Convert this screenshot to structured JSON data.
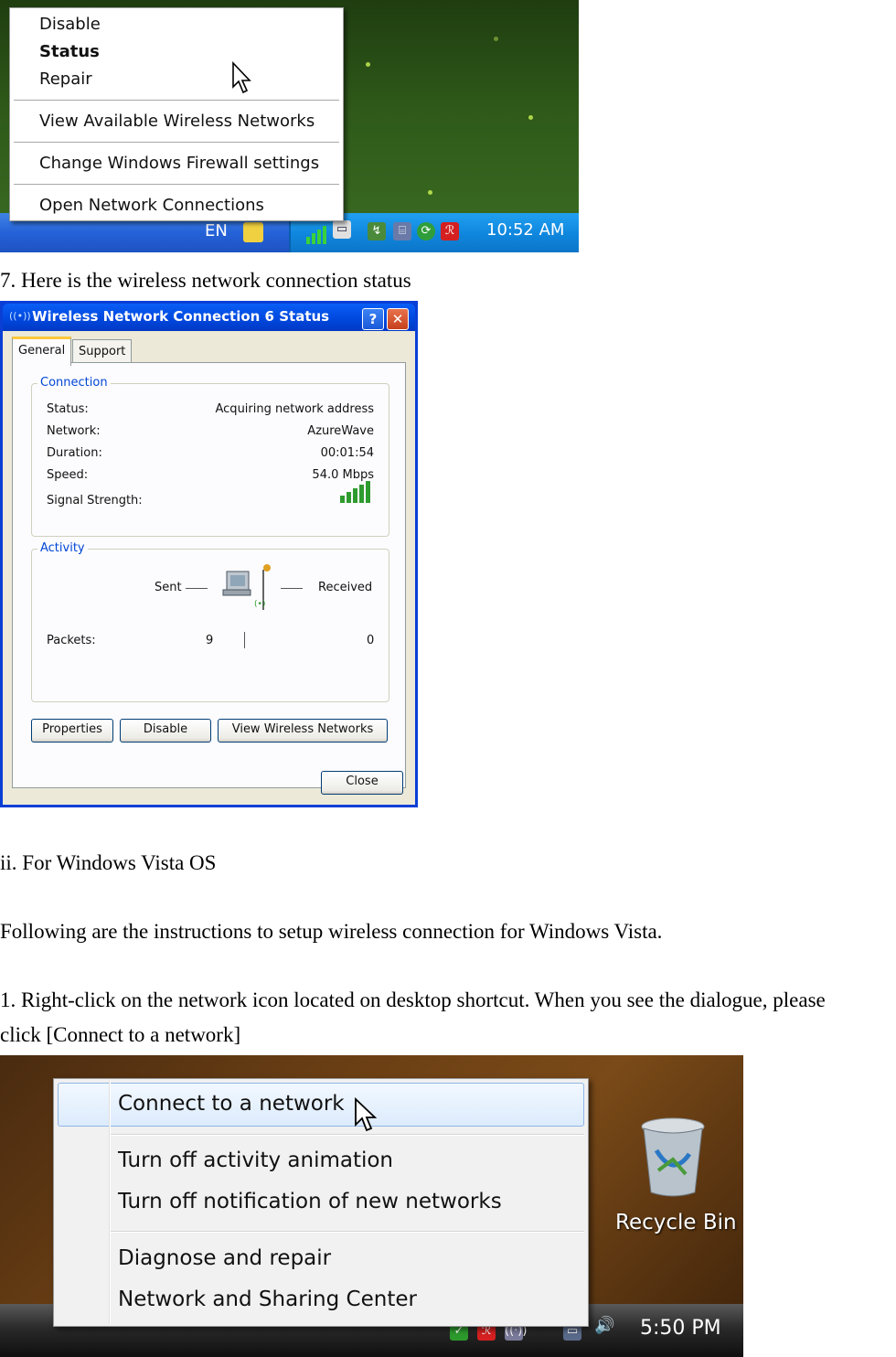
{
  "xp_menu": {
    "items": [
      "Disable",
      "Status",
      "Repair",
      "View Available Wireless Networks",
      "Change Windows Firewall settings",
      "Open Network Connections"
    ],
    "bold_item": "Status"
  },
  "xp_taskbar": {
    "language": "EN",
    "clock": "10:52 AM"
  },
  "caption_status": "7. Here is the wireless network connection status",
  "status_dialog": {
    "title": "Wireless Network Connection 6 Status",
    "help_btn": "?",
    "close_x": "✕",
    "tabs": [
      "General",
      "Support"
    ],
    "connection": {
      "group_label": "Connection",
      "status_label": "Status:",
      "status_value": "Acquiring network address",
      "network_label": "Network:",
      "network_value": "AzureWave",
      "duration_label": "Duration:",
      "duration_value": "00:01:54",
      "speed_label": "Speed:",
      "speed_value": "54.0 Mbps",
      "signal_label": "Signal Strength:",
      "signal_bars": 5
    },
    "activity": {
      "group_label": "Activity",
      "sent_label": "Sent",
      "received_label": "Received",
      "packets_label": "Packets:",
      "packets_sent": "9",
      "packets_received": "0"
    },
    "buttons": {
      "properties": "Properties",
      "disable": "Disable",
      "view_wireless": "View Wireless Networks",
      "close": "Close"
    }
  },
  "heading_vista": "ii. For Windows Vista OS",
  "intro_vista": "Following are the instructions to setup wireless connection for Windows Vista.",
  "step1_line1": "1. Right-click on the network icon located on desktop shortcut. When you see the dialogue, please",
  "step1_line2": "click [Connect to a network]",
  "vista_menu": {
    "items": [
      "Connect to a network",
      "Turn off activity animation",
      "Turn off notification of new networks",
      "Diagnose and repair",
      "Network and Sharing Center"
    ]
  },
  "vista_desktop": {
    "recycle_bin_label": "Recycle Bin",
    "clock": "5:50 PM"
  },
  "colors": {
    "xp_title_blue": "#0047dc",
    "xp_group_label": "#0046d5",
    "signal_green": "#2e9b2e"
  }
}
